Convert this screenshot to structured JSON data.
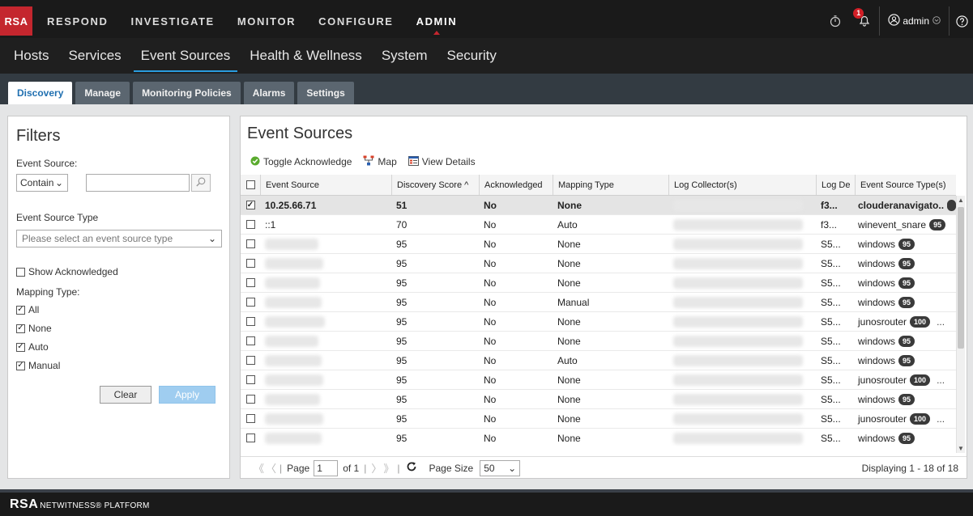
{
  "brand": {
    "logo": "RSA",
    "footer_logo_mark": "RSA",
    "footer_logo_text": "NETWITNESS® PLATFORM"
  },
  "main_nav": [
    "RESPOND",
    "INVESTIGATE",
    "MONITOR",
    "CONFIGURE",
    "ADMIN"
  ],
  "main_nav_active": "ADMIN",
  "user": {
    "name": "admin",
    "notifications": "1"
  },
  "sub_nav": [
    "Hosts",
    "Services",
    "Event Sources",
    "Health & Wellness",
    "System",
    "Security"
  ],
  "sub_nav_active": "Event Sources",
  "tabs": [
    "Discovery",
    "Manage",
    "Monitoring Policies",
    "Alarms",
    "Settings"
  ],
  "tab_active": "Discovery",
  "filters": {
    "title": "Filters",
    "event_source_label": "Event Source:",
    "match_mode": "Contain",
    "event_source_value": "",
    "event_source_type_label": "Event Source Type",
    "event_source_type_placeholder": "Please select an event source type",
    "show_acknowledged_label": "Show Acknowledged",
    "show_acknowledged": false,
    "mapping_type_label": "Mapping Type:",
    "mapping_types": [
      {
        "label": "All",
        "checked": true
      },
      {
        "label": "None",
        "checked": true
      },
      {
        "label": "Auto",
        "checked": true
      },
      {
        "label": "Manual",
        "checked": true
      }
    ],
    "clear_label": "Clear",
    "apply_label": "Apply"
  },
  "panel": {
    "title": "Event Sources",
    "toolbar": {
      "toggle_ack": "Toggle Acknowledge",
      "map": "Map",
      "view_details": "View Details"
    }
  },
  "table": {
    "columns": [
      "Event Source",
      "Discovery Score ^",
      "Acknowledged",
      "Mapping Type",
      "Log Collector(s)",
      "Log De",
      "Event Source Type(s)"
    ],
    "rows": [
      {
        "checked": true,
        "source": "10.25.66.71",
        "score": "51",
        "ack": "No",
        "mapping": "None",
        "logde": "f3...",
        "type": "clouderanavigato..",
        "count": "",
        "more": false
      },
      {
        "checked": false,
        "source": "::1",
        "score": "70",
        "ack": "No",
        "mapping": "Auto",
        "logde": "f3...",
        "type": "winevent_snare",
        "count": "95",
        "more": false
      },
      {
        "checked": false,
        "source": "",
        "score": "95",
        "ack": "No",
        "mapping": "None",
        "logde": "S5...",
        "type": "windows",
        "count": "95",
        "more": false
      },
      {
        "checked": false,
        "source": "",
        "score": "95",
        "ack": "No",
        "mapping": "None",
        "logde": "S5...",
        "type": "windows",
        "count": "95",
        "more": false
      },
      {
        "checked": false,
        "source": "",
        "score": "95",
        "ack": "No",
        "mapping": "None",
        "logde": "S5...",
        "type": "windows",
        "count": "95",
        "more": false
      },
      {
        "checked": false,
        "source": "",
        "score": "95",
        "ack": "No",
        "mapping": "Manual",
        "logde": "S5...",
        "type": "windows",
        "count": "95",
        "more": false
      },
      {
        "checked": false,
        "source": "",
        "score": "95",
        "ack": "No",
        "mapping": "None",
        "logde": "S5...",
        "type": "junosrouter",
        "count": "100",
        "more": true
      },
      {
        "checked": false,
        "source": "",
        "score": "95",
        "ack": "No",
        "mapping": "None",
        "logde": "S5...",
        "type": "windows",
        "count": "95",
        "more": false
      },
      {
        "checked": false,
        "source": "",
        "score": "95",
        "ack": "No",
        "mapping": "Auto",
        "logde": "S5...",
        "type": "windows",
        "count": "95",
        "more": false
      },
      {
        "checked": false,
        "source": "",
        "score": "95",
        "ack": "No",
        "mapping": "None",
        "logde": "S5...",
        "type": "junosrouter",
        "count": "100",
        "more": true
      },
      {
        "checked": false,
        "source": "",
        "score": "95",
        "ack": "No",
        "mapping": "None",
        "logde": "S5...",
        "type": "windows",
        "count": "95",
        "more": false
      },
      {
        "checked": false,
        "source": "",
        "score": "95",
        "ack": "No",
        "mapping": "None",
        "logde": "S5...",
        "type": "junosrouter",
        "count": "100",
        "more": true
      },
      {
        "checked": false,
        "source": "",
        "score": "95",
        "ack": "No",
        "mapping": "None",
        "logde": "S5...",
        "type": "windows",
        "count": "95",
        "more": false
      }
    ]
  },
  "pager": {
    "page_label": "Page",
    "page": "1",
    "of_label": "of 1",
    "page_size_label": "Page Size",
    "page_size": "50",
    "displaying": "Displaying 1 - 18 of 18"
  },
  "colors": {
    "brand_red": "#c4262e",
    "accent_blue": "#2a9de0",
    "tab_active_text": "#1f6fb0"
  }
}
